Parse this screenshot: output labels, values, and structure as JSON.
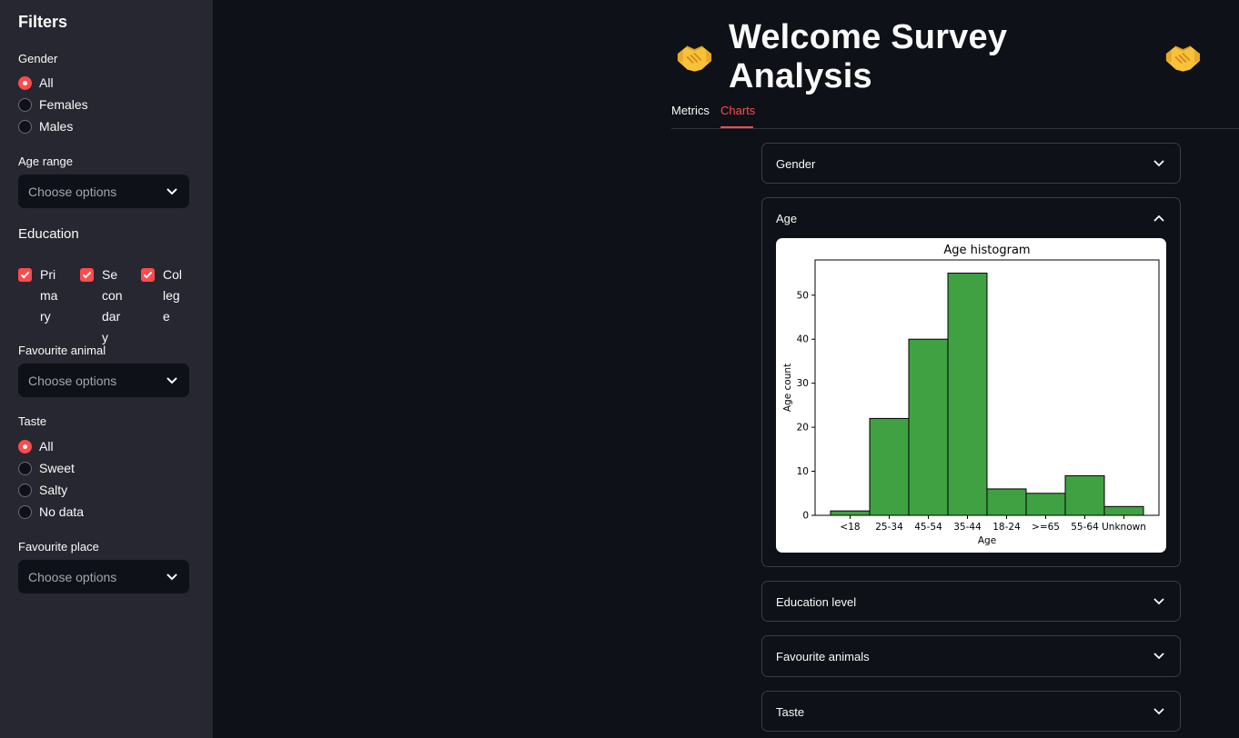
{
  "sidebar": {
    "title": "Filters",
    "gender": {
      "label": "Gender",
      "options": [
        "All",
        "Females",
        "Males"
      ],
      "selected": "All"
    },
    "age_range": {
      "label": "Age range",
      "placeholder": "Choose options"
    },
    "education": {
      "label": "Education",
      "options": [
        "Primary",
        "Secondary",
        "College"
      ]
    },
    "favourite_animal": {
      "label": "Favourite animal",
      "placeholder": "Choose options"
    },
    "taste": {
      "label": "Taste",
      "options": [
        "All",
        "Sweet",
        "Salty",
        "No data"
      ],
      "selected": "All"
    },
    "favourite_place": {
      "label": "Favourite place",
      "placeholder": "Choose options"
    }
  },
  "main": {
    "title": "Welcome Survey Analysis",
    "title_emoji": "handshake",
    "tabs": [
      {
        "label": "Metrics"
      },
      {
        "label": "Charts"
      }
    ],
    "active_tab": "Charts",
    "expanders": [
      {
        "label": "Gender"
      },
      {
        "label": "Age"
      },
      {
        "label": "Education level"
      },
      {
        "label": "Favourite animals"
      },
      {
        "label": "Taste"
      }
    ]
  },
  "colors": {
    "accent": "#ff4b4b",
    "bar": "#3fa142",
    "background": "#0e1117",
    "sidebar": "#262730"
  },
  "chart_data": {
    "type": "bar",
    "title": "Age histogram",
    "xlabel": "Age",
    "ylabel": "Age count",
    "categories": [
      "<18",
      "25-34",
      "45-54",
      "35-44",
      "18-24",
      ">=65",
      "55-64",
      "Unknown"
    ],
    "values": [
      1,
      22,
      40,
      55,
      6,
      5,
      9,
      2
    ],
    "ylim": [
      0,
      58
    ],
    "yticks": [
      0,
      10,
      20,
      30,
      40,
      50
    ],
    "grid": false
  }
}
